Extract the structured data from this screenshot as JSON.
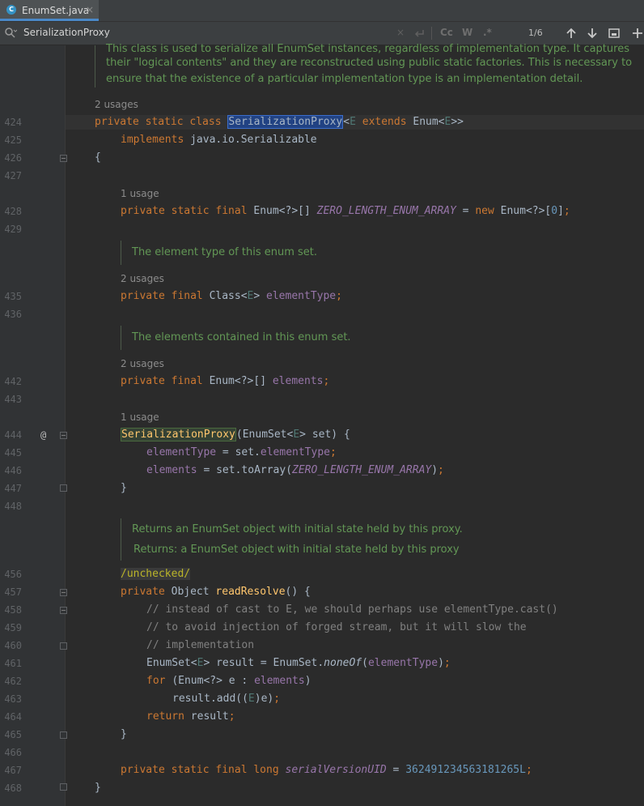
{
  "tab": {
    "label": "EnumSet.java",
    "icon_letter": "C",
    "close": "×"
  },
  "find": {
    "query": "SerializationProxy",
    "match_count": "1/6",
    "options": [
      "Cc",
      "W",
      ".*"
    ]
  },
  "gutter": {
    "line_numbers": [
      "424",
      "425",
      "426",
      "427",
      "428",
      "429",
      "435",
      "436",
      "442",
      "443",
      "444",
      "445",
      "446",
      "447",
      "448",
      "456",
      "457",
      "458",
      "459",
      "460",
      "461",
      "462",
      "463",
      "464",
      "465",
      "466",
      "467",
      "468"
    ],
    "override_marker": "@"
  },
  "doc_top": [
    "This class is used to serialize all EnumSet instances, regardless of implementation type. It captures",
    "their \"logical contents\" and they are reconstructed using public static factories. This is necessary to",
    "ensure that the existence of a particular implementation type is an implementation detail."
  ],
  "usages": {
    "class": "2 usages",
    "zero_array": "1 usage",
    "element_type": "2 usages",
    "elements": "2 usages",
    "ctor": "1 usage"
  },
  "docs": {
    "element_type": "The element type of this enum set.",
    "elements": "The elements contained in this enum set.",
    "resolve_main": "Returns an EnumSet object with initial state held by this proxy.",
    "resolve_returns": "Returns: a EnumSet object with initial state held by this proxy"
  },
  "annotation": "/unchecked/",
  "comments": [
    "// instead of cast to E, we should perhaps use elementType.cast()",
    "// to avoid injection of forged stream, but it will slow the",
    "// implementation"
  ],
  "serial_value": "362491234563181265L"
}
